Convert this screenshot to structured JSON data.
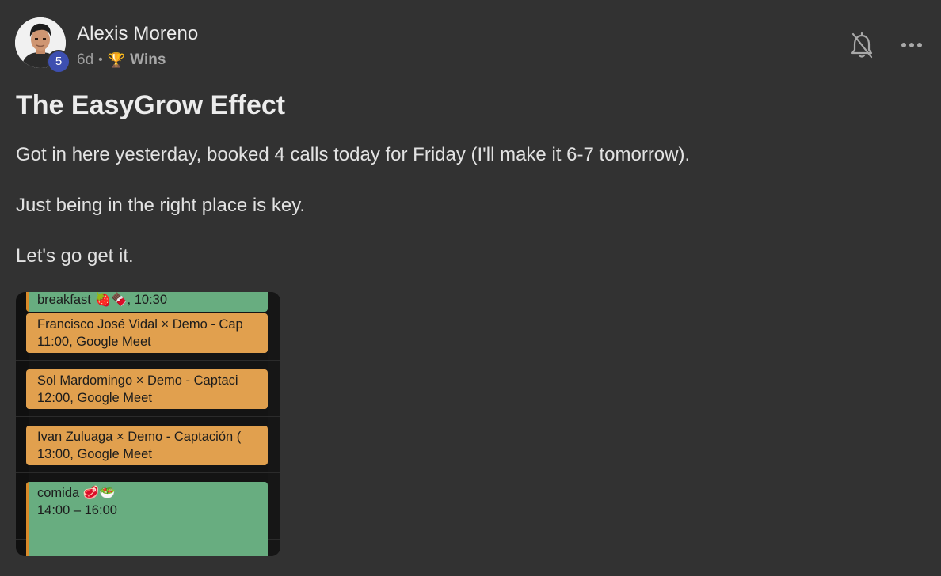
{
  "post": {
    "author": "Alexis Moreno",
    "level": "5",
    "time_ago": "6d",
    "separator": "•",
    "category_icon": "trophy-icon",
    "category_glyph": "🏆",
    "category": "Wins",
    "title": "The EasyGrow Effect",
    "paragraphs": [
      "Got in here yesterday, booked 4 calls today for Friday (I'll make it 6-7 tomorrow).",
      "Just being in the right place is key.",
      "Let's go get it."
    ]
  },
  "actions": {
    "notification_icon": "bell-off-icon",
    "more_icon": "more-horizontal-icon"
  },
  "attachment": {
    "events": [
      {
        "title": "breakfast 🍓🍫, 10:30",
        "subtitle": "",
        "color": "#68ad80"
      },
      {
        "title": "Francisco José Vidal × Demo - Cap",
        "subtitle": "11:00, Google Meet",
        "color": "#e1a04e"
      },
      {
        "title": "Sol Mardomingo × Demo - Captaci",
        "subtitle": "12:00, Google Meet",
        "color": "#e1a04e"
      },
      {
        "title": "Ivan Zuluaga × Demo - Captación (",
        "subtitle": "13:00, Google Meet",
        "color": "#e1a04e"
      },
      {
        "title": "comida 🥩🥗",
        "subtitle": "14:00 – 16:00",
        "color": "#68ad80"
      }
    ]
  },
  "colors": {
    "background": "#323232",
    "level_badge": "#3d4fb0",
    "text_primary": "#ececec",
    "text_muted": "#9d9d9d"
  }
}
